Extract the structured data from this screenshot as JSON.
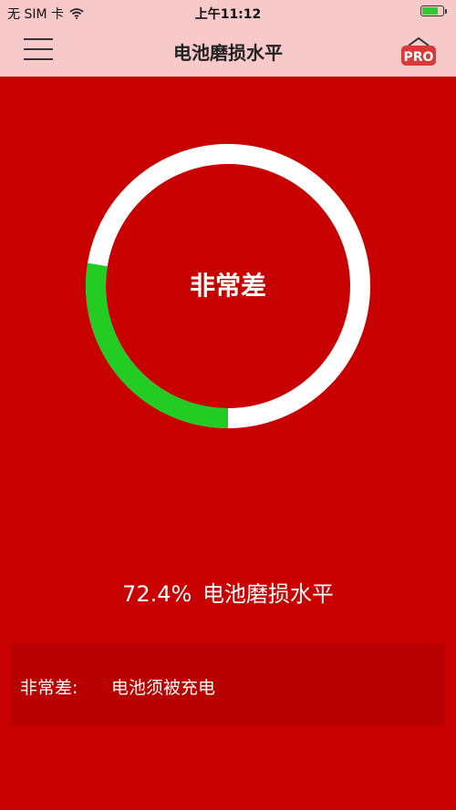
{
  "status_bar": {
    "carrier": "无 SIM 卡",
    "time": "上午11:12",
    "battery_level": 0.8
  },
  "nav": {
    "title": "电池磨损水平",
    "pro_label": "PRO"
  },
  "gauge": {
    "status_label": "非常差",
    "track_color": "#ffffff",
    "fill_color": "#22cc22",
    "fill_fraction": 0.276
  },
  "summary": {
    "percent": "72.4%",
    "caption": "电池磨损水平"
  },
  "advice": {
    "prefix": "非常差:",
    "message": "电池须被充电"
  },
  "colors": {
    "background": "#c90000",
    "header": "#f7c9c9",
    "panel": "#b80000"
  }
}
